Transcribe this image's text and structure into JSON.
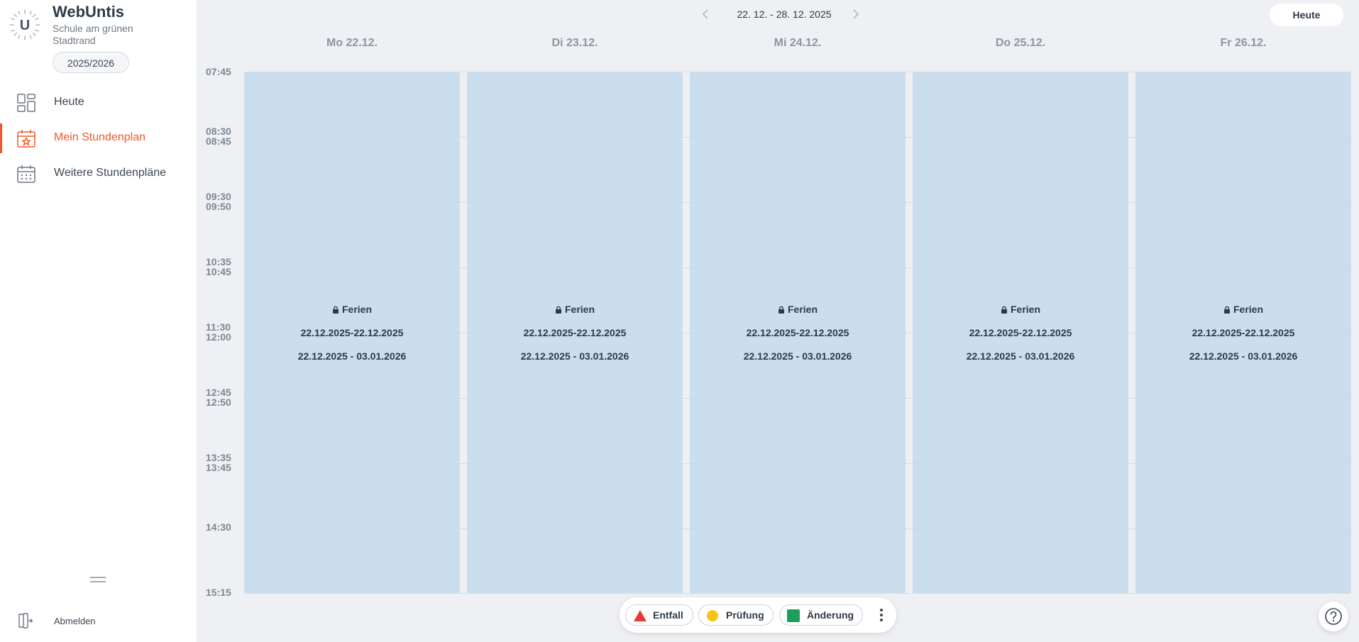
{
  "app": {
    "name": "WebUntis",
    "school": "Schule am grünen Stadtrand",
    "school_year": "2025/2026",
    "logo_letter": "U"
  },
  "nav": {
    "items": [
      {
        "label": "Heute",
        "icon": "dashboard-icon",
        "active": false
      },
      {
        "label": "Mein Stundenplan",
        "icon": "calendar-star-icon",
        "active": true
      },
      {
        "label": "Weitere Stundenpläne",
        "icon": "calendar-grid-icon",
        "active": false
      }
    ],
    "logout_label": "Abmelden"
  },
  "header": {
    "week_range": "22. 12. - 28. 12. 2025",
    "today_label": "Heute"
  },
  "days": [
    {
      "label": "Mo 22.12."
    },
    {
      "label": "Di 23.12."
    },
    {
      "label": "Mi 24.12."
    },
    {
      "label": "Do 25.12."
    },
    {
      "label": "Fr 26.12."
    }
  ],
  "times": [
    "07:45",
    "08:30",
    "08:45",
    "09:30",
    "09:50",
    "10:35",
    "10:45",
    "11:30",
    "12:00",
    "12:45",
    "12:50",
    "13:35",
    "13:45",
    "14:30",
    "15:15"
  ],
  "holiday": {
    "title": "Ferien",
    "line1": "22.12.2025-22.12.2025",
    "line2": "22.12.2025 - 03.01.2026"
  },
  "legend": {
    "items": [
      {
        "label": "Entfall",
        "color": "#e53935",
        "shape": "triangle"
      },
      {
        "label": "Prüfung",
        "color": "#f5c518",
        "shape": "circle"
      },
      {
        "label": "Änderung",
        "color": "#1e9e5a",
        "shape": "square"
      }
    ]
  },
  "colors": {
    "accent": "#f0582a",
    "holiday_block": "#c9deed"
  }
}
